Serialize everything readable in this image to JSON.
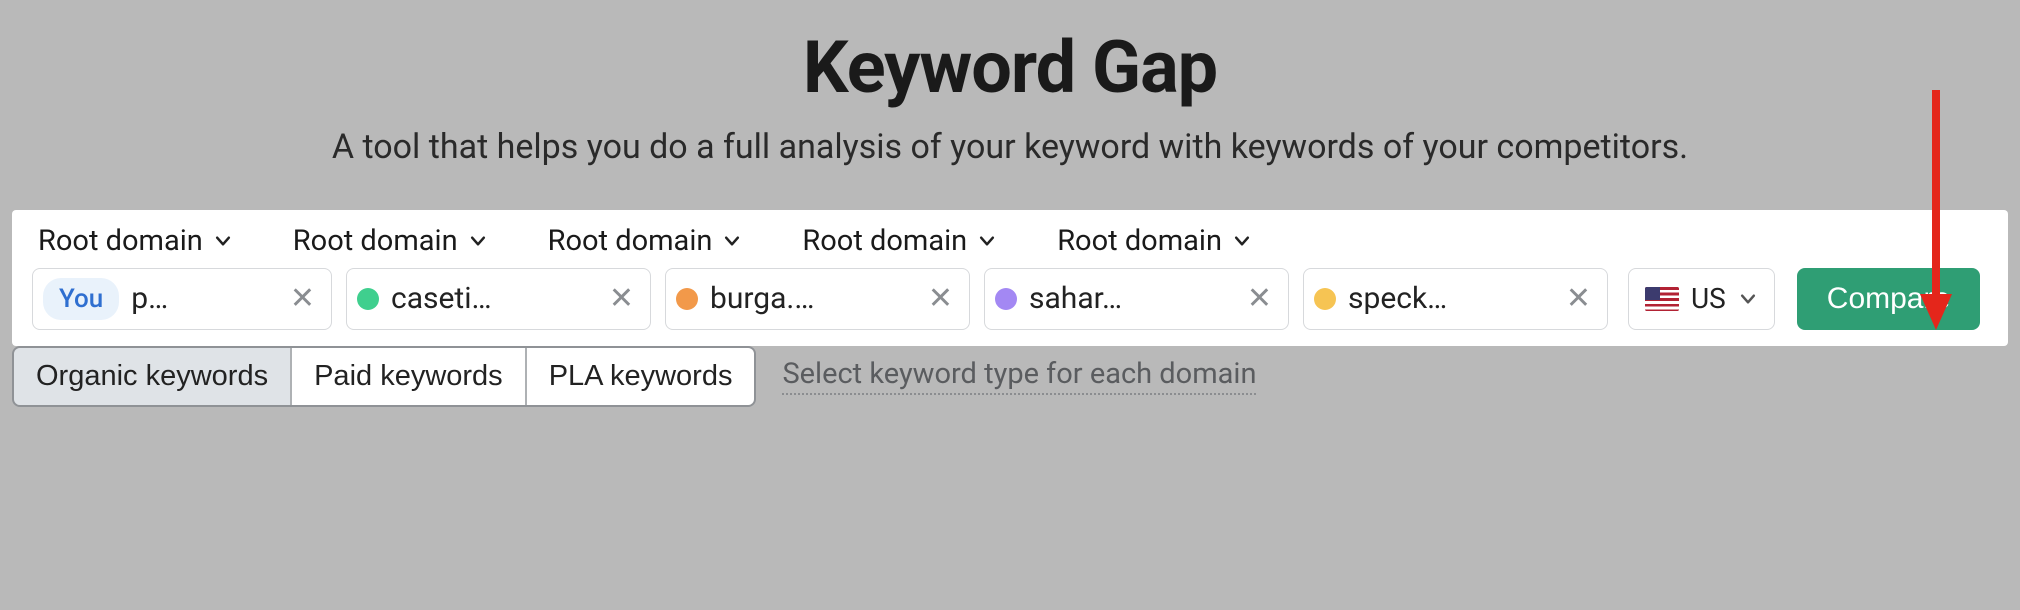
{
  "header": {
    "title": "Keyword Gap",
    "subtitle": "A tool that helps you do a full analysis of your keyword with keywords of your competitors."
  },
  "scope_label": "Root domain",
  "domains": [
    {
      "badge": "You",
      "text": "p…",
      "color": null
    },
    {
      "text": "caseti…",
      "color": "#3fcf8e"
    },
    {
      "text": "burga.…",
      "color": "#f2994a"
    },
    {
      "text": "sahar…",
      "color": "#a388f3"
    },
    {
      "text": "speck…",
      "color": "#f6c453"
    }
  ],
  "country": {
    "code": "US"
  },
  "compare_label": "Compare",
  "tabs": {
    "organic": "Organic keywords",
    "paid": "Paid keywords",
    "pla": "PLA keywords"
  },
  "type_link": "Select keyword type for each domain"
}
